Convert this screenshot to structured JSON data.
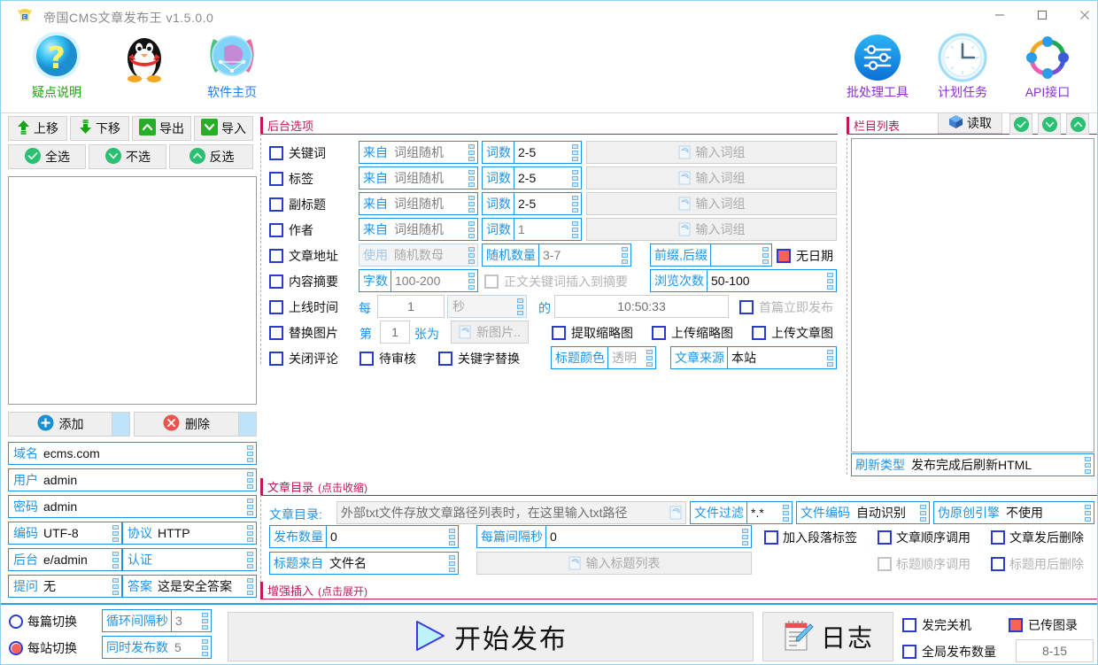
{
  "window": {
    "title": "帝国CMS文章发布王 v1.5.0.0",
    "minimize": "—",
    "maximize": "□",
    "close": "✕"
  },
  "toolbar": {
    "items": [
      {
        "label": "疑点说明",
        "icon": "question-mark-icon"
      },
      {
        "label": "",
        "icon": "qq-penguin-icon"
      },
      {
        "label": "软件主页",
        "icon": "globe-icon"
      },
      {
        "label": "批处理工具",
        "icon": "sliders-icon"
      },
      {
        "label": "计划任务",
        "icon": "clock-icon"
      },
      {
        "label": "API接口",
        "icon": "api-ring-icon"
      }
    ]
  },
  "left_panel": {
    "buttons_row1": [
      {
        "label": "上移",
        "icon": "arrow-up-icon"
      },
      {
        "label": "下移",
        "icon": "arrow-down-icon"
      },
      {
        "label": "导出",
        "icon": "chevron-up-box-icon"
      },
      {
        "label": "导入",
        "icon": "chevron-down-box-icon"
      }
    ],
    "buttons_row2": [
      {
        "label": "全选",
        "icon": "check-circle-icon"
      },
      {
        "label": "不选",
        "icon": "chevron-down-circle-icon"
      },
      {
        "label": "反选",
        "icon": "chevron-up-circle-icon"
      }
    ],
    "add_label": "添加",
    "delete_label": "删除",
    "fields": [
      {
        "label": "域名",
        "value": "ecms.com"
      },
      {
        "label": "用户",
        "value": "admin"
      },
      {
        "label": "密码",
        "value": "admin"
      }
    ],
    "encoding": {
      "label": "编码",
      "value": "UTF-8"
    },
    "protocol": {
      "label": "协议",
      "value": "HTTP"
    },
    "backend": {
      "label": "后台",
      "value": "e/admin"
    },
    "auth": {
      "label": "认证",
      "value": ""
    },
    "question": {
      "label": "提问",
      "value": "无"
    },
    "answer": {
      "label": "答案",
      "value": "这是安全答案"
    }
  },
  "backend_options": {
    "title": "后台选项",
    "rows": [
      {
        "checkbox": "关键词",
        "source_label": "来自",
        "source_value": "词组随机",
        "count_label": "词数",
        "count_value": "2-5",
        "input_placeholder": "输入词组"
      },
      {
        "checkbox": "标签",
        "source_label": "来自",
        "source_value": "词组随机",
        "count_label": "词数",
        "count_value": "2-5",
        "input_placeholder": "输入词组"
      },
      {
        "checkbox": "副标题",
        "source_label": "来自",
        "source_value": "词组随机",
        "count_label": "词数",
        "count_value": "2-5",
        "input_placeholder": "输入词组"
      },
      {
        "checkbox": "作者",
        "source_label": "来自",
        "source_value": "词组随机",
        "count_label": "词数",
        "count_value": "1",
        "input_placeholder": "输入词组"
      }
    ],
    "article_url": {
      "checkbox": "文章地址",
      "use_label": "使用",
      "use_value": "随机数母",
      "qty_label": "随机数量",
      "qty_value": "3-7",
      "affix_label": "前缀,后缀",
      "affix_value": "",
      "nodate_label": "无日期",
      "nodate_checked": true
    },
    "summary": {
      "checkbox": "内容摘要",
      "words_label": "字数",
      "words_value": "100-200",
      "insert_keyword_label": "正文关键词插入到摘要",
      "views_label": "浏览次数",
      "views_value": "50-100"
    },
    "online_time": {
      "checkbox": "上线时间",
      "every_label": "每",
      "every_value": "1",
      "unit_value": "秒",
      "of_label": "的",
      "time_value": "10:50:33",
      "first_now_label": "首篇立即发布"
    },
    "replace_image": {
      "checkbox": "替换图片",
      "nth_label": "第",
      "nth_value": "1",
      "nth_suffix": "张为",
      "newimg_placeholder": "新图片..",
      "extract_thumb": "提取缩略图",
      "upload_thumb": "上传缩略图",
      "upload_article_img": "上传文章图"
    },
    "misc": {
      "close_comment": "关闭评论",
      "pending_review": "待审核",
      "keyword_replace": "关键字替换",
      "title_color_label": "标题颜色",
      "title_color_value": "透明",
      "article_source_label": "文章来源",
      "article_source_value": "本站"
    }
  },
  "column_list": {
    "title": "栏目列表",
    "read_label": "读取",
    "read_icon": "cube-icon",
    "tool_icons": [
      "check-circle-icon",
      "chevron-down-circle-icon",
      "chevron-up-circle-icon"
    ],
    "refresh_label": "刷新类型",
    "refresh_value": "发布完成后刷新HTML"
  },
  "article_dir": {
    "title": "文章目录",
    "title_hint": "(点击收缩)",
    "dir_label": "文章目录:",
    "dir_placeholder": "外部txt文件存放文章路径列表时，在这里输入txt路径",
    "filter_label": "文件过滤",
    "filter_value": "*.*",
    "encoding_label": "文件编码",
    "encoding_value": "自动识别",
    "spin_label": "伪原创引擎",
    "spin_value": "不使用",
    "publish_count_label": "发布数量",
    "publish_count_value": "0",
    "interval_label": "每篇间隔秒",
    "interval_value": "0",
    "add_para_tag": "加入段落标签",
    "article_order": "文章顺序调用",
    "article_del": "文章发后删除",
    "title_from_label": "标题来自",
    "title_from_value": "文件名",
    "title_list_placeholder": "输入标题列表",
    "title_order": "标题顺序调用",
    "title_del": "标题用后删除"
  },
  "enhanced_insert": {
    "title": "增强插入",
    "title_hint": "(点击展开)"
  },
  "bottom": {
    "radio_per_article": "每篇切换",
    "radio_per_site": "每站切换",
    "radio_selected": "每站切换",
    "loop_interval_label": "循环间隔秒",
    "loop_interval_value": "3",
    "concurrent_label": "同时发布数",
    "concurrent_value": "5",
    "start_label": "开始发布",
    "log_label": "日志",
    "shutdown_label": "发完关机",
    "uploaded_label": "已传图录",
    "uploaded_checked": true,
    "global_count_label": "全局发布数量",
    "global_count_value": "8-15"
  }
}
